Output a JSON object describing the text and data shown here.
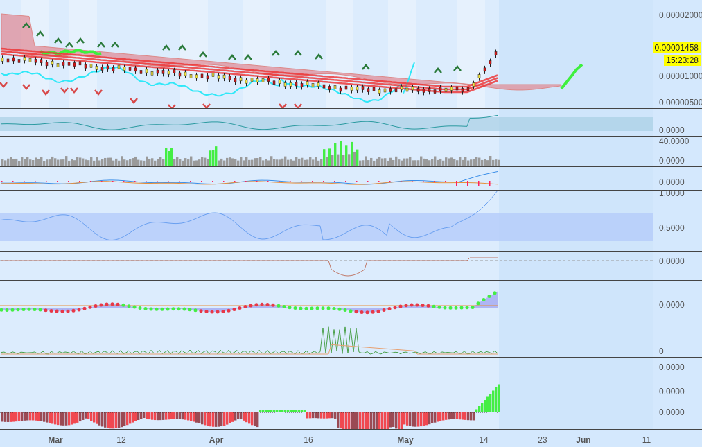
{
  "panes": [
    {
      "kind": "price",
      "labels": [
        "0.00002000",
        "0.00001000",
        "0.00000500"
      ]
    },
    {
      "kind": "band",
      "labels": [
        "0.0000"
      ]
    },
    {
      "kind": "volume",
      "labels": [
        "40.0000",
        "0.0000"
      ]
    },
    {
      "kind": "macd",
      "labels": [
        "0.0000"
      ]
    },
    {
      "kind": "rsi",
      "labels": [
        "1.0000",
        "0.5000"
      ]
    },
    {
      "kind": "flat",
      "labels": [
        "0.0000"
      ]
    },
    {
      "kind": "dots",
      "labels": [
        "0.0000"
      ]
    },
    {
      "kind": "spikes",
      "labels": [
        "0"
      ]
    },
    {
      "kind": "empty",
      "labels": [
        "0.0000"
      ]
    },
    {
      "kind": "histogram",
      "labels": [
        "0.0000",
        "0.0000"
      ]
    }
  ],
  "last_price": {
    "price": "0.00001458",
    "time": "15:23:28"
  },
  "x_axis": [
    {
      "label": "Mar",
      "kind": "month"
    },
    {
      "label": "12",
      "kind": "day"
    },
    {
      "label": "Apr",
      "kind": "month"
    },
    {
      "label": "16",
      "kind": "day"
    },
    {
      "label": "May",
      "kind": "month"
    },
    {
      "label": "14",
      "kind": "day"
    },
    {
      "label": "23",
      "kind": "day"
    },
    {
      "label": "Jun",
      "kind": "month"
    },
    {
      "label": "11",
      "kind": "day"
    }
  ]
}
